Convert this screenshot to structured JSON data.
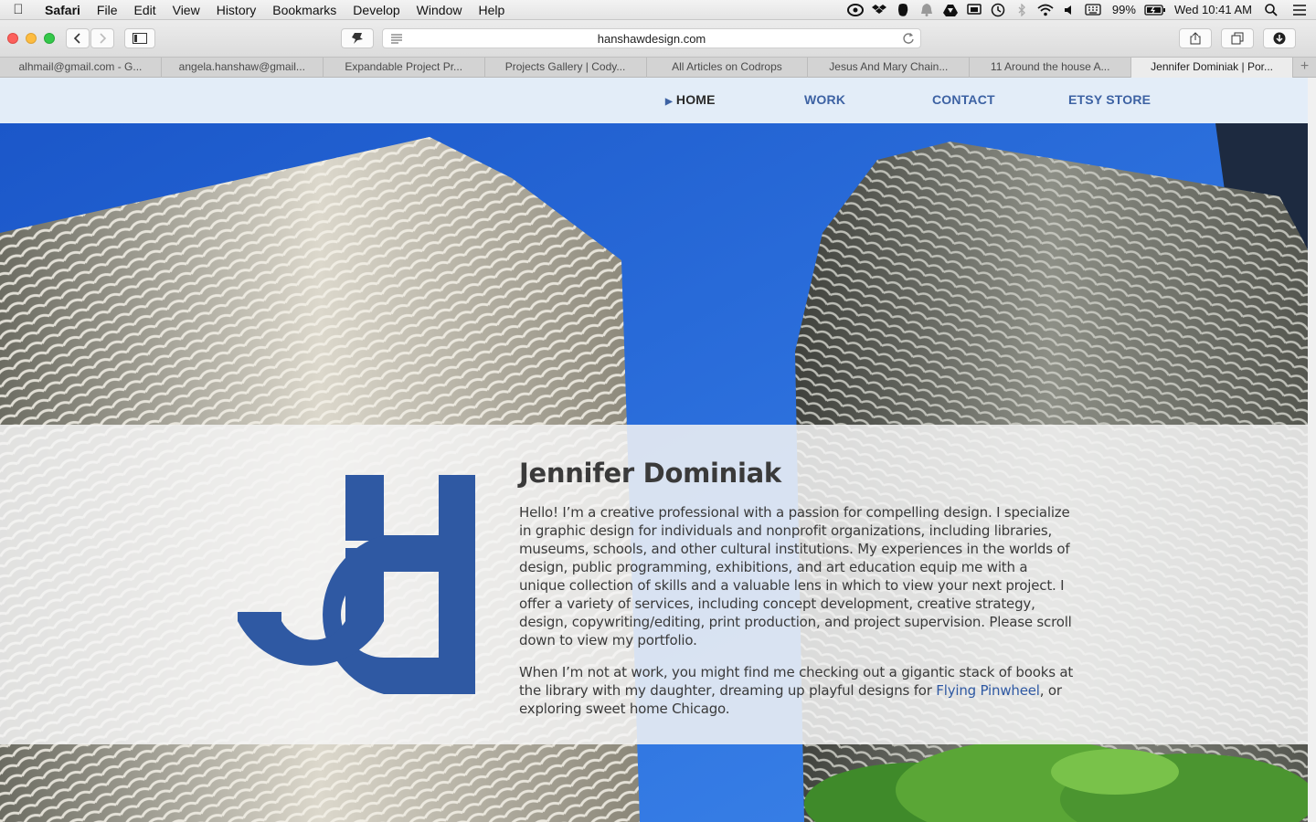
{
  "menubar": {
    "app_name": "Safari",
    "items": [
      "File",
      "Edit",
      "View",
      "History",
      "Bookmarks",
      "Develop",
      "Window",
      "Help"
    ],
    "battery": "99%",
    "clock": "Wed 10:41 AM"
  },
  "browser": {
    "url": "hanshawdesign.com",
    "tabs": [
      "alhmail@gmail.com - G...",
      "angela.hanshaw@gmail...",
      "Expandable Project Pr...",
      "Projects Gallery | Cody...",
      "All Articles on Codrops",
      "Jesus And Mary Chain...",
      "11 Around the house A...",
      "Jennifer Dominiak | Por..."
    ],
    "active_tab": 7
  },
  "site": {
    "nav": {
      "home": "HOME",
      "work": "WORK",
      "contact": "CONTACT",
      "etsy": "ETSY STORE"
    },
    "intro": {
      "title": "Jennifer Dominiak",
      "paragraph1": "Hello! I’m a creative professional with a passion for compelling design. I specialize in graphic design for individuals and nonprofit organizations, including libraries, museums, schools, and other cultural institutions. My experiences in the worlds of design, public programming, exhibitions, and art education equip me with a unique collection of skills and a valuable lens in which to view your next project. I offer a variety of services, including concept development, creative strategy, design, copywriting/editing, print production, and project supervision. Please scroll down to view my portfolio.",
      "paragraph2_before": "When I’m not at work, you might find me checking out a gigantic stack of books at the library with my daughter, dreaming up playful designs for ",
      "paragraph2_link": "Flying Pinwheel",
      "paragraph2_after": ", or exploring sweet home Chicago."
    },
    "logo_icon": "jd-monogram-logo",
    "colors": {
      "brand_blue": "#2f59a3",
      "sky": "#2a66d6"
    }
  }
}
